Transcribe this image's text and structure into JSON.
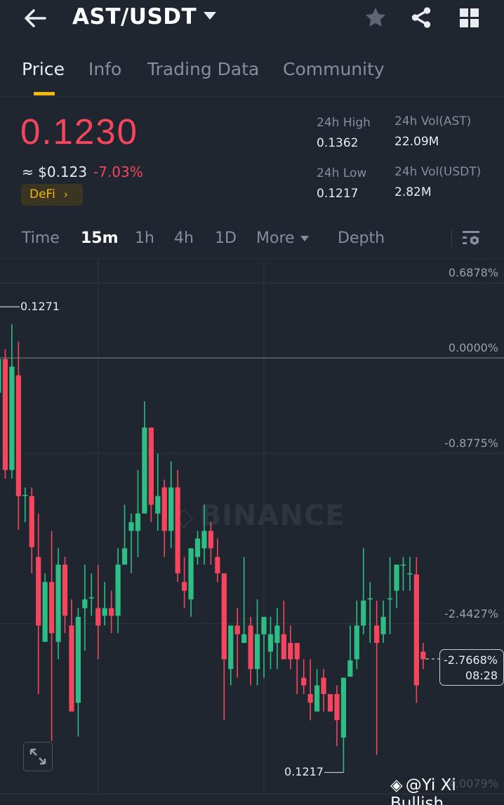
{
  "header": {
    "title": "AST/USDT"
  },
  "tabs": [
    {
      "label": "Price",
      "active": true
    },
    {
      "label": "Info"
    },
    {
      "label": "Trading Data"
    },
    {
      "label": "Community"
    }
  ],
  "ticker": {
    "last_price": "0.1230",
    "usd_price": "≈ $0.123",
    "change": "-7.03%",
    "tag": "DeFi",
    "stats": {
      "high_label": "24h High",
      "high": "0.1362",
      "low_label": "24h Low",
      "low": "0.1217",
      "vol_base_label": "24h Vol(AST)",
      "vol_base": "22.09M",
      "vol_quote_label": "24h Vol(USDT)",
      "vol_quote": "2.82M"
    }
  },
  "intervals": [
    "Time",
    "15m",
    "1h",
    "4h",
    "1D",
    "More",
    "Depth"
  ],
  "colors": {
    "up": "#2ebd85",
    "down": "#f6465d",
    "accent": "#f0b90b",
    "bg": "#1f2630"
  },
  "chart_data": {
    "type": "candlestick",
    "y_unit": "percent change",
    "y_ticks": [
      {
        "value": 0.6878,
        "label": "0.6878%"
      },
      {
        "value": 0,
        "label": "0.0000%"
      },
      {
        "value": -0.8775,
        "label": "-0.8775%"
      },
      {
        "value": -2.4427,
        "label": "-2.4427%"
      },
      {
        "value": -4.0079,
        "label": "-4.0079%"
      }
    ],
    "max_marker": {
      "label": "0.1271",
      "value": 0.47
    },
    "min_marker": {
      "label": "0.1217",
      "value": -3.81
    },
    "current": {
      "label": "-2.7668%",
      "countdown": "08:28",
      "value": -2.7668
    },
    "candles_ohlc": [
      [
        -0.32,
        0.06,
        -0.35,
        -0.01
      ],
      [
        -0.01,
        0.08,
        -1.11,
        -1.03
      ],
      [
        -1.03,
        0.31,
        -1.11,
        -0.08
      ],
      [
        -0.16,
        0.15,
        -1.58,
        -1.27
      ],
      [
        -1.27,
        -1.19,
        -1.51,
        -1.26
      ],
      [
        -1.27,
        -1.19,
        -1.98,
        -1.74
      ],
      [
        -1.83,
        -1.43,
        -3.09,
        -2.46
      ],
      [
        -2.61,
        -1.98,
        -2.61,
        -2.06
      ],
      [
        -2.06,
        -1.59,
        -3.52,
        -2.53
      ],
      [
        -2.61,
        -1.75,
        -2.77,
        -1.9
      ],
      [
        -1.9,
        -1.83,
        -2.53,
        -2.37
      ],
      [
        -2.46,
        -2.22,
        -3.25,
        -3.25
      ],
      [
        -3.17,
        -2.3,
        -3.48,
        -2.38
      ],
      [
        -2.3,
        -1.9,
        -2.69,
        -2.22
      ],
      [
        -2.21,
        -1.98,
        -2.37,
        -2.2
      ],
      [
        -2.3,
        -1.9,
        -2.77,
        -2.46
      ],
      [
        -2.37,
        -2.06,
        -2.46,
        -2.3
      ],
      [
        -2.3,
        -2.14,
        -2.53,
        -2.37
      ],
      [
        -2.37,
        -1.75,
        -2.53,
        -1.9
      ],
      [
        -1.9,
        -1.35,
        -1.9,
        -1.75
      ],
      [
        -1.59,
        -1.43,
        -1.98,
        -1.51
      ],
      [
        -1.59,
        -1.03,
        -1.83,
        -1.43
      ],
      [
        -1.43,
        -0.4,
        -1.43,
        -0.64
      ],
      [
        -0.64,
        -0.64,
        -1.51,
        -1.35
      ],
      [
        -1.43,
        -0.88,
        -1.59,
        -1.27
      ],
      [
        -1.19,
        -1.12,
        -1.83,
        -1.59
      ],
      [
        -1.59,
        -0.95,
        -1.75,
        -1.19
      ],
      [
        -1.19,
        -1.03,
        -2.06,
        -1.98
      ],
      [
        -2.06,
        -1.83,
        -2.3,
        -2.14
      ],
      [
        -2.22,
        -1.75,
        -2.38,
        -1.75
      ],
      [
        -1.83,
        -1.59,
        -1.9,
        -1.66
      ],
      [
        -1.75,
        -1.35,
        -1.9,
        -1.59
      ],
      [
        -1.59,
        -1.51,
        -1.9,
        -1.75
      ],
      [
        -1.83,
        -1.66,
        -2.06,
        -1.98
      ],
      [
        -1.98,
        -1.98,
        -3.33,
        -2.77
      ],
      [
        -2.86,
        -2.46,
        -3.01,
        -2.46
      ],
      [
        -2.46,
        -2.3,
        -2.94,
        -2.54
      ],
      [
        -2.62,
        -1.83,
        -2.62,
        -2.54
      ],
      [
        -2.46,
        -2.38,
        -3.01,
        -2.86
      ],
      [
        -2.86,
        -2.22,
        -3.01,
        -2.54
      ],
      [
        -2.54,
        -2.38,
        -2.94,
        -2.38
      ],
      [
        -2.7,
        -2.38,
        -2.86,
        -2.54
      ],
      [
        -2.62,
        -2.3,
        -2.86,
        -2.46
      ],
      [
        -2.54,
        -2.23,
        -2.77,
        -2.77
      ],
      [
        -2.62,
        -2.46,
        -2.86,
        -2.77
      ],
      [
        -2.62,
        -2.62,
        -3.09,
        -2.77
      ],
      [
        -2.94,
        -2.77,
        -3.09,
        -3.01
      ],
      [
        -3.09,
        -2.77,
        -3.33,
        -3.17
      ],
      [
        -3.25,
        -2.86,
        -3.25,
        -3.01
      ],
      [
        -2.94,
        -2.86,
        -3.25,
        -3.09
      ],
      [
        -3.09,
        -3.09,
        -3.25,
        -3.25
      ],
      [
        -3.09,
        -3.01,
        -3.57,
        -3.33
      ],
      [
        -3.49,
        -2.94,
        -3.81,
        -2.94
      ],
      [
        -2.93,
        -2.46,
        -2.93,
        -2.78
      ],
      [
        -2.77,
        -2.23,
        -2.86,
        -2.46
      ],
      [
        -2.46,
        -1.75,
        -2.54,
        -2.23
      ],
      [
        -2.22,
        -2.06,
        -2.62,
        -2.21
      ],
      [
        -2.46,
        -2.23,
        -3.65,
        -2.62
      ],
      [
        -2.54,
        -2.23,
        -2.62,
        -2.38
      ],
      [
        -2.22,
        -1.83,
        -2.54,
        -2.21
      ],
      [
        -2.14,
        -1.9,
        -2.3,
        -1.9
      ],
      [
        -1.91,
        -1.83,
        -2.14,
        -1.9
      ],
      [
        -1.99,
        -1.83,
        -2.14,
        -1.98
      ],
      [
        -1.99,
        -1.83,
        -3.17,
        -3.01
      ],
      [
        -2.7,
        -2.62,
        -2.86,
        -2.77
      ]
    ]
  },
  "watermark": "BINANCE",
  "overlay_handle": "@Yi Xi Bullish"
}
